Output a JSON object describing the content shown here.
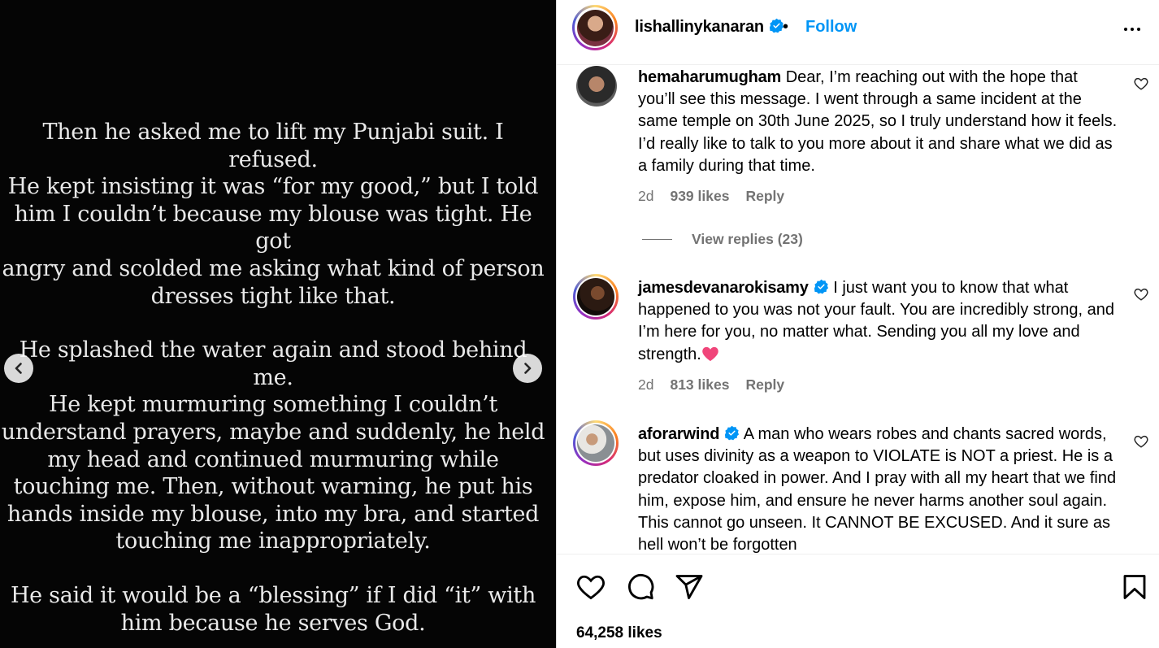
{
  "post": {
    "paragraphs": [
      "Then he asked me to lift my Punjabi suit. I refused.\nHe kept insisting it was “for my good,” but I told\nhim I couldn’t because my blouse was tight. He got\nangry and scolded me asking what kind of person\ndresses tight like that.",
      "He splashed the water again and stood behind me.\nHe kept murmuring something I couldn’t\nunderstand prayers, maybe and suddenly, he held\nmy head and continued murmuring while\ntouching me. Then, without warning, he put his\nhands inside my blouse, into my bra, and started\ntouching me inappropriately.",
      "He said it would be a “blessing” if I did “it” with\nhim because he serves God."
    ]
  },
  "header": {
    "username": "lishallinykanaran",
    "separator": "•",
    "follow_label": "Follow"
  },
  "comments": [
    {
      "username": "hemaharumugham",
      "verified": false,
      "text": "Dear, I’m reaching out with the hope that you’ll see this message. I went through a same incident at the same temple on 30th June 2025, so I truly understand how it feels. I’d really like to talk to you more about it and share what we did as a family during that time.",
      "time": "2d",
      "likes": "939 likes",
      "reply_label": "Reply",
      "view_replies": "View replies (23)"
    },
    {
      "username": "jamesdevanarokisamy",
      "verified": true,
      "text": "I just want you to know that what happened to you was not your fault. You are incredibly strong, and I’m here for you, no matter what. Sending you all my love and strength.",
      "time": "2d",
      "likes": "813 likes",
      "reply_label": "Reply"
    },
    {
      "username": "aforarwind",
      "verified": true,
      "text": "A man who wears robes and chants sacred words, but uses divinity as a weapon to VIOLATE is NOT a priest. He is a predator cloaked in power. And I pray with all my heart that we find him, expose him, and ensure he never harms another soul again. This cannot go unseen. It CANNOT BE EXCUSED. And it sure as hell won’t be forgotten"
    }
  ],
  "footer": {
    "likes_count": "64,258 likes"
  },
  "colors": {
    "accent": "#0095f6",
    "muted": "#737373",
    "media_bg": "#050505"
  },
  "icons": [
    "chevron-left-icon",
    "chevron-right-icon",
    "verified-icon",
    "more-icon",
    "heart-icon",
    "comment-icon",
    "share-icon",
    "bookmark-icon"
  ]
}
